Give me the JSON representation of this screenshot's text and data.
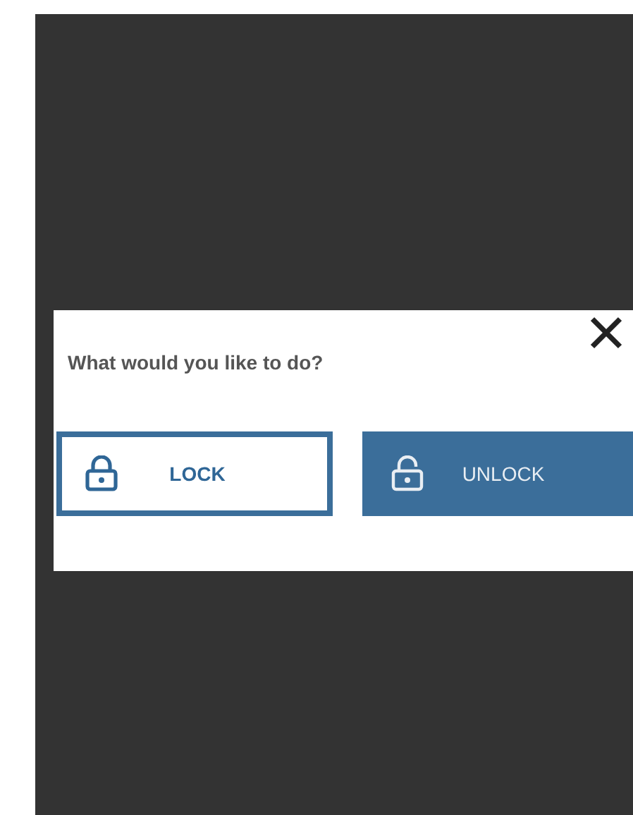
{
  "dialog": {
    "title": "What would you like to do?",
    "buttons": [
      {
        "label": "LOCK",
        "kind": "outline"
      },
      {
        "label": "UNLOCK",
        "kind": "filled"
      }
    ]
  }
}
